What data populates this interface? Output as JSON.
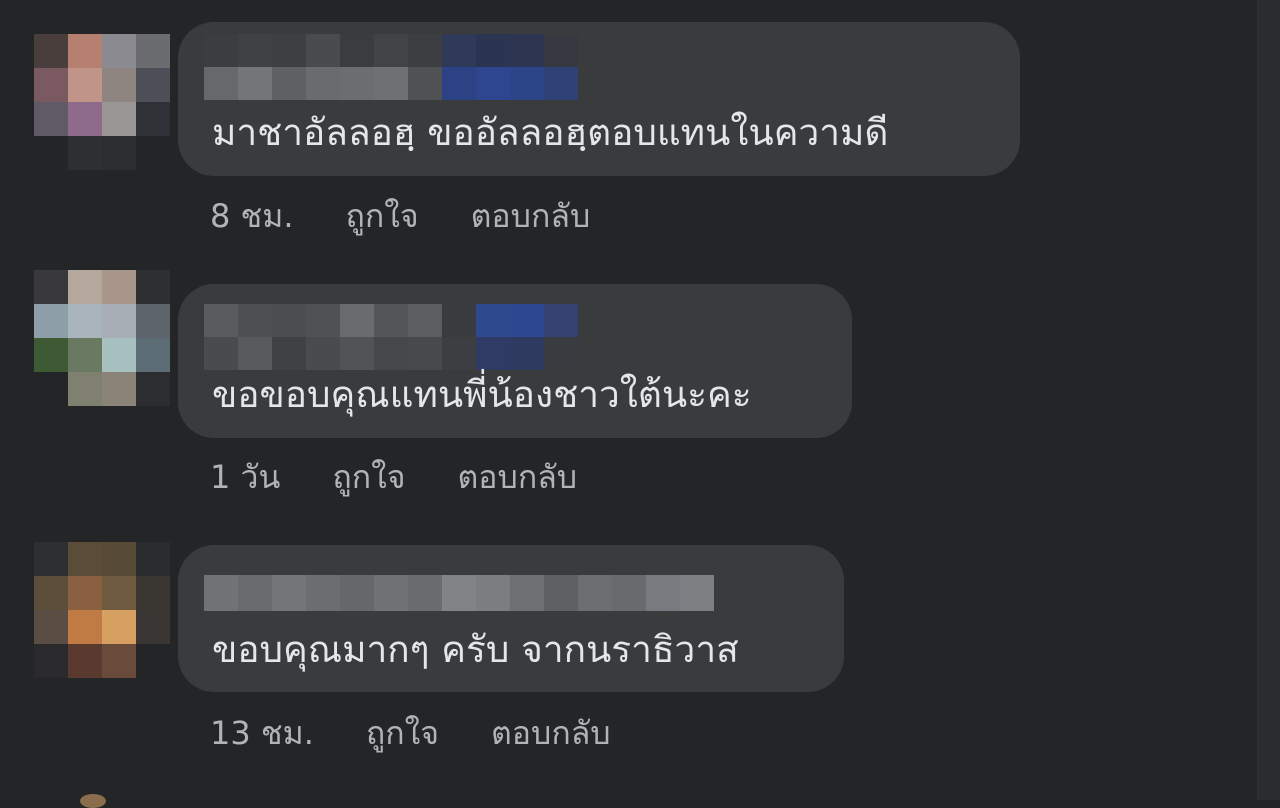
{
  "comments": [
    {
      "text": "มาชาอัลลอฮฺ ขออัลลอฮฺตอบแทนในความดี",
      "timestamp": "8 ชม.",
      "like_label": "ถูกใจ",
      "reply_label": "ตอบกลับ"
    },
    {
      "text": "ขอขอบคุณแทนพี่น้องชาวใต้นะคะ",
      "timestamp": "1 วัน",
      "like_label": "ถูกใจ",
      "reply_label": "ตอบกลับ"
    },
    {
      "text": "ขอบคุณมากๆ ครับ จากนราธิวาส",
      "timestamp": "13 ชม.",
      "like_label": "ถูกใจ",
      "reply_label": "ตอบกลับ"
    }
  ],
  "colors": {
    "background": "#242527",
    "bubble": "#3a3b3c",
    "text_primary": "#e4e6eb",
    "text_secondary": "#b0b3b8"
  }
}
